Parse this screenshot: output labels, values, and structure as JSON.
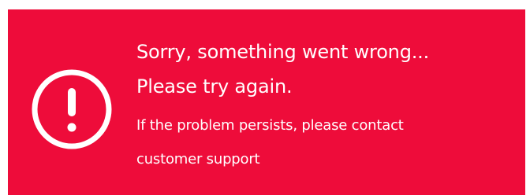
{
  "banner": {
    "background_color": "#EE0C3A",
    "text_color": "#FFFFFF",
    "icon": "exclamation-circle-icon",
    "headline_line_1": "Sorry, something went wrong...",
    "headline_line_2": "Please try again.",
    "detail_line_1": "If the problem persists, please contact",
    "detail_line_2": "customer support"
  }
}
